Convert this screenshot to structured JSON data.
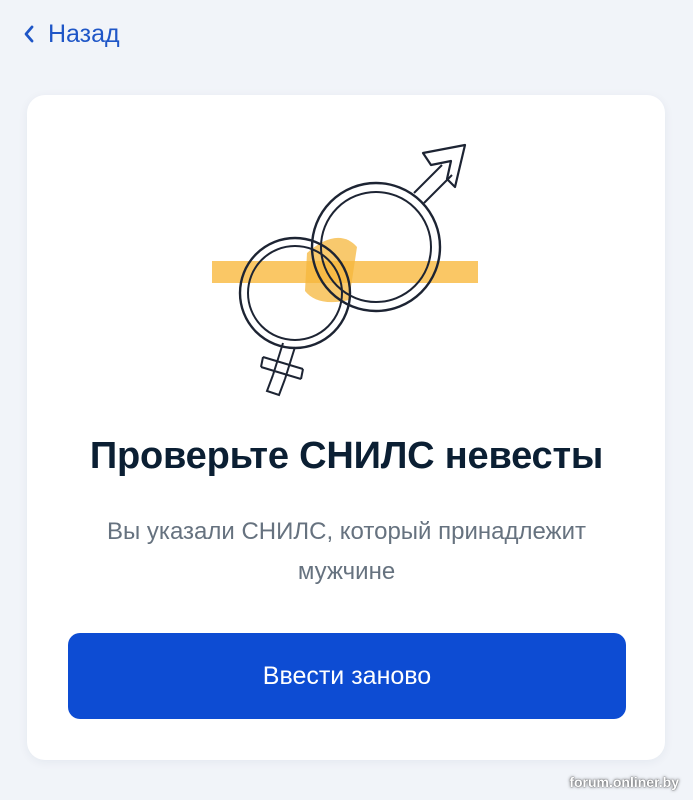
{
  "nav": {
    "back_label": "Назад",
    "back_icon": "chevron-left-icon"
  },
  "illustration": {
    "icon": "gender-rings-icon",
    "highlight_color": "#f6b73c"
  },
  "content": {
    "title": "Проверьте СНИЛС невесты",
    "subtitle": "Вы указали СНИЛС, который принадлежит мужчине"
  },
  "actions": {
    "primary_label": "Ввести заново"
  },
  "watermark": "forum.onliner.by",
  "colors": {
    "accent": "#0d4cd3",
    "link": "#1f56c7",
    "background": "#f1f4f9",
    "title": "#0b1f33",
    "subtitle": "#66727f"
  }
}
